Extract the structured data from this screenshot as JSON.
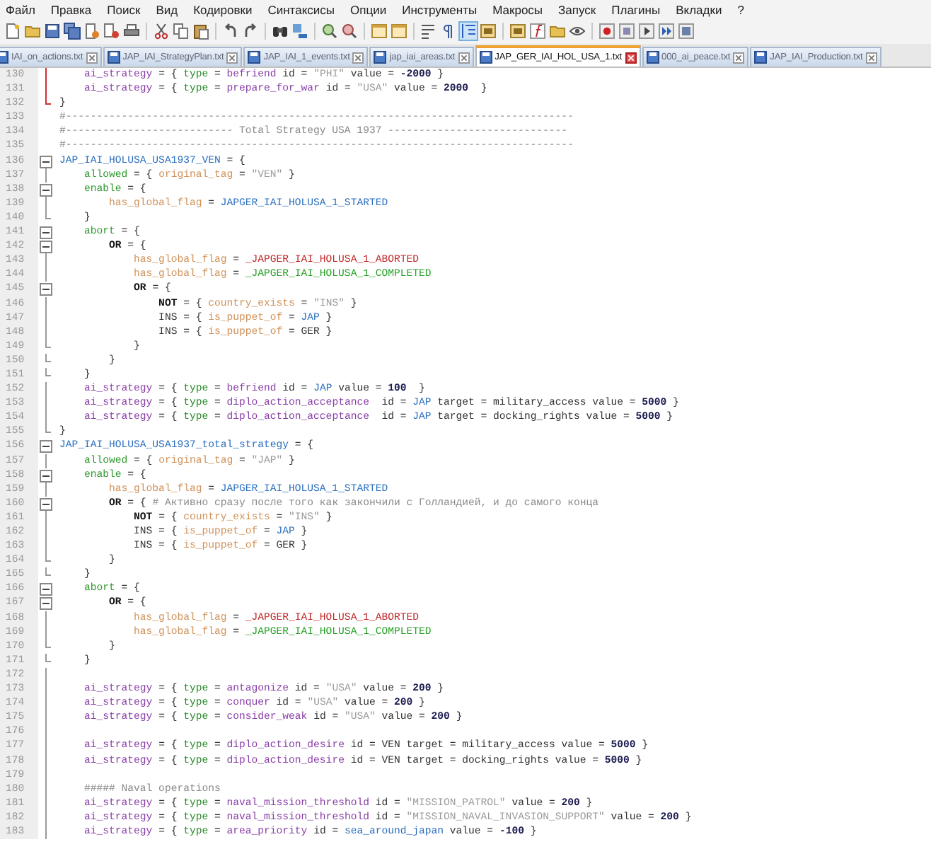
{
  "menu": [
    "Файл",
    "Правка",
    "Поиск",
    "Вид",
    "Кодировки",
    "Синтаксисы",
    "Опции",
    "Инструменты",
    "Макросы",
    "Запуск",
    "Плагины",
    "Вкладки",
    "?"
  ],
  "tabs": [
    {
      "label": "IAI_on_actions.txt",
      "selected": false
    },
    {
      "label": "JAP_IAI_StrategyPlan.txt",
      "selected": false
    },
    {
      "label": "JAP_IAI_1_events.txt",
      "selected": false
    },
    {
      "label": "jap_iai_areas.txt",
      "selected": false
    },
    {
      "label": "JAP_GER_IAI_HOL_USA_1.txt",
      "selected": true
    },
    {
      "label": "000_ai_peace.txt",
      "selected": false
    },
    {
      "label": "JAP_IAI_Production.txt",
      "selected": false
    }
  ],
  "lines": [
    {
      "number": "130",
      "kind": "inner",
      "current": true,
      "tokens": [
        {
          "kind": "keyword",
          "text": "    ai_strategy"
        },
        {
          "kind": "plain",
          "text": " = { "
        },
        {
          "kind": "type",
          "text": "type"
        },
        {
          "kind": "plain",
          "text": " = "
        },
        {
          "kind": "keyword",
          "text": "befriend"
        },
        {
          "kind": "plain",
          "text": " id = "
        },
        {
          "kind": "string",
          "text": "\"PHI\""
        },
        {
          "kind": "plain",
          "text": " value = "
        },
        {
          "kind": "number",
          "text": "-2000"
        },
        {
          "kind": "plain",
          "text": " }"
        }
      ]
    },
    {
      "number": "131",
      "kind": "inner",
      "current": true,
      "tokens": [
        {
          "kind": "keyword",
          "text": "    ai_strategy"
        },
        {
          "kind": "plain",
          "text": " = { "
        },
        {
          "kind": "type",
          "text": "type"
        },
        {
          "kind": "plain",
          "text": " = "
        },
        {
          "kind": "keyword",
          "text": "prepare_for_war"
        },
        {
          "kind": "plain",
          "text": " id = "
        },
        {
          "kind": "string",
          "text": "\"USA\""
        },
        {
          "kind": "plain",
          "text": " value = "
        },
        {
          "kind": "number",
          "text": "2000"
        },
        {
          "kind": "plain",
          "text": "  }"
        }
      ]
    },
    {
      "number": "132",
      "kind": "end",
      "current": true,
      "tokens": [
        {
          "kind": "plain",
          "text": "}"
        }
      ]
    },
    {
      "number": "133",
      "kind": "plain",
      "current": false,
      "tokens": [
        {
          "kind": "comment",
          "text": "#----------------------------------------------------------------------------------"
        }
      ]
    },
    {
      "number": "134",
      "kind": "plain",
      "current": false,
      "tokens": [
        {
          "kind": "comment",
          "text": "#--------------------------- Total Strategy USA 1937 -----------------------------"
        }
      ]
    },
    {
      "number": "135",
      "kind": "plain",
      "current": false,
      "tokens": [
        {
          "kind": "comment",
          "text": "#----------------------------------------------------------------------------------"
        }
      ]
    },
    {
      "number": "136",
      "kind": "open",
      "current": false,
      "tokens": [
        {
          "kind": "tag",
          "text": "JAP_IAI_HOLUSA_USA1937_VEN"
        },
        {
          "kind": "plain",
          "text": " = {"
        }
      ]
    },
    {
      "number": "137",
      "kind": "inner",
      "current": false,
      "tokens": [
        {
          "kind": "block",
          "text": "    allowed"
        },
        {
          "kind": "plain",
          "text": " = { "
        },
        {
          "kind": "trigger",
          "text": "original_tag"
        },
        {
          "kind": "plain",
          "text": " = "
        },
        {
          "kind": "string",
          "text": "\"VEN\""
        },
        {
          "kind": "plain",
          "text": " }"
        }
      ]
    },
    {
      "number": "138",
      "kind": "open",
      "current": false,
      "tokens": [
        {
          "kind": "block",
          "text": "    enable"
        },
        {
          "kind": "plain",
          "text": " = {"
        }
      ]
    },
    {
      "number": "139",
      "kind": "inner",
      "current": false,
      "tokens": [
        {
          "kind": "trigger",
          "text": "        has_global_flag"
        },
        {
          "kind": "plain",
          "text": " = "
        },
        {
          "kind": "tag",
          "text": "JAPGER_IAI_HOLUSA_1_STARTED"
        }
      ]
    },
    {
      "number": "140",
      "kind": "end",
      "current": false,
      "tokens": [
        {
          "kind": "plain",
          "text": "    }"
        }
      ]
    },
    {
      "number": "141",
      "kind": "open",
      "current": false,
      "tokens": [
        {
          "kind": "block",
          "text": "    abort"
        },
        {
          "kind": "plain",
          "text": " = {"
        }
      ]
    },
    {
      "number": "142",
      "kind": "open",
      "current": false,
      "tokens": [
        {
          "kind": "logic",
          "text": "        OR"
        },
        {
          "kind": "plain",
          "text": " = {"
        }
      ]
    },
    {
      "number": "143",
      "kind": "inner",
      "current": false,
      "tokens": [
        {
          "kind": "trigger",
          "text": "            has_global_flag"
        },
        {
          "kind": "plain",
          "text": " = "
        },
        {
          "kind": "aborted",
          "text": "_JAPGER_IAI_HOLUSA_1_ABORTED"
        }
      ]
    },
    {
      "number": "144",
      "kind": "inner",
      "current": false,
      "tokens": [
        {
          "kind": "trigger",
          "text": "            has_global_flag"
        },
        {
          "kind": "plain",
          "text": " = "
        },
        {
          "kind": "completed",
          "text": "_JAPGER_IAI_HOLUSA_1_COMPLETED"
        }
      ]
    },
    {
      "number": "145",
      "kind": "open",
      "current": false,
      "tokens": [
        {
          "kind": "logic",
          "text": "            OR"
        },
        {
          "kind": "plain",
          "text": " = {"
        }
      ]
    },
    {
      "number": "146",
      "kind": "inner",
      "current": false,
      "tokens": [
        {
          "kind": "logic",
          "text": "                NOT"
        },
        {
          "kind": "plain",
          "text": " = { "
        },
        {
          "kind": "trigger",
          "text": "country_exists"
        },
        {
          "kind": "plain",
          "text": " = "
        },
        {
          "kind": "string",
          "text": "\"INS\""
        },
        {
          "kind": "plain",
          "text": " }"
        }
      ]
    },
    {
      "number": "147",
      "kind": "inner",
      "current": false,
      "tokens": [
        {
          "kind": "plain",
          "text": "                INS = { "
        },
        {
          "kind": "trigger",
          "text": "is_puppet_of"
        },
        {
          "kind": "plain",
          "text": " = "
        },
        {
          "kind": "tag",
          "text": "JAP"
        },
        {
          "kind": "plain",
          "text": " }"
        }
      ]
    },
    {
      "number": "148",
      "kind": "inner",
      "current": false,
      "tokens": [
        {
          "kind": "plain",
          "text": "                INS = { "
        },
        {
          "kind": "trigger",
          "text": "is_puppet_of"
        },
        {
          "kind": "plain",
          "text": " = GER }"
        }
      ]
    },
    {
      "number": "149",
      "kind": "end",
      "current": false,
      "tokens": [
        {
          "kind": "plain",
          "text": "            }"
        }
      ]
    },
    {
      "number": "150",
      "kind": "end",
      "current": false,
      "tokens": [
        {
          "kind": "plain",
          "text": "        }"
        }
      ]
    },
    {
      "number": "151",
      "kind": "end",
      "current": false,
      "tokens": [
        {
          "kind": "plain",
          "text": "    }"
        }
      ]
    },
    {
      "number": "152",
      "kind": "inner",
      "current": false,
      "tokens": [
        {
          "kind": "keyword",
          "text": "    ai_strategy"
        },
        {
          "kind": "plain",
          "text": " = { "
        },
        {
          "kind": "type",
          "text": "type"
        },
        {
          "kind": "plain",
          "text": " = "
        },
        {
          "kind": "keyword",
          "text": "befriend"
        },
        {
          "kind": "plain",
          "text": " id = "
        },
        {
          "kind": "tag",
          "text": "JAP"
        },
        {
          "kind": "plain",
          "text": " value = "
        },
        {
          "kind": "number",
          "text": "100"
        },
        {
          "kind": "plain",
          "text": "  }"
        }
      ]
    },
    {
      "number": "153",
      "kind": "inner",
      "current": false,
      "tokens": [
        {
          "kind": "keyword",
          "text": "    ai_strategy"
        },
        {
          "kind": "plain",
          "text": " = { "
        },
        {
          "kind": "type",
          "text": "type"
        },
        {
          "kind": "plain",
          "text": " = "
        },
        {
          "kind": "keyword",
          "text": "diplo_action_acceptance"
        },
        {
          "kind": "plain",
          "text": "  id = "
        },
        {
          "kind": "tag",
          "text": "JAP"
        },
        {
          "kind": "plain",
          "text": " target = military_access value = "
        },
        {
          "kind": "number",
          "text": "5000"
        },
        {
          "kind": "plain",
          "text": " }"
        }
      ]
    },
    {
      "number": "154",
      "kind": "inner",
      "current": false,
      "tokens": [
        {
          "kind": "keyword",
          "text": "    ai_strategy"
        },
        {
          "kind": "plain",
          "text": " = { "
        },
        {
          "kind": "type",
          "text": "type"
        },
        {
          "kind": "plain",
          "text": " = "
        },
        {
          "kind": "keyword",
          "text": "diplo_action_acceptance"
        },
        {
          "kind": "plain",
          "text": "  id = "
        },
        {
          "kind": "tag",
          "text": "JAP"
        },
        {
          "kind": "plain",
          "text": " target = docking_rights value = "
        },
        {
          "kind": "number",
          "text": "5000"
        },
        {
          "kind": "plain",
          "text": " }"
        }
      ]
    },
    {
      "number": "155",
      "kind": "end",
      "current": false,
      "tokens": [
        {
          "kind": "plain",
          "text": "}"
        }
      ]
    },
    {
      "number": "156",
      "kind": "open",
      "current": false,
      "tokens": [
        {
          "kind": "tag",
          "text": "JAP_IAI_HOLUSA_USA1937_total_strategy"
        },
        {
          "kind": "plain",
          "text": " = {"
        }
      ]
    },
    {
      "number": "157",
      "kind": "inner",
      "current": false,
      "tokens": [
        {
          "kind": "block",
          "text": "    allowed"
        },
        {
          "kind": "plain",
          "text": " = { "
        },
        {
          "kind": "trigger",
          "text": "original_tag"
        },
        {
          "kind": "plain",
          "text": " = "
        },
        {
          "kind": "string",
          "text": "\"JAP\""
        },
        {
          "kind": "plain",
          "text": " }"
        }
      ]
    },
    {
      "number": "158",
      "kind": "open",
      "current": false,
      "tokens": [
        {
          "kind": "block",
          "text": "    enable"
        },
        {
          "kind": "plain",
          "text": " = {"
        }
      ]
    },
    {
      "number": "159",
      "kind": "inner",
      "current": false,
      "tokens": [
        {
          "kind": "trigger",
          "text": "        has_global_flag"
        },
        {
          "kind": "plain",
          "text": " = "
        },
        {
          "kind": "tag",
          "text": "JAPGER_IAI_HOLUSA_1_STARTED"
        }
      ]
    },
    {
      "number": "160",
      "kind": "open",
      "current": false,
      "tokens": [
        {
          "kind": "logic",
          "text": "        OR"
        },
        {
          "kind": "plain",
          "text": " = { "
        },
        {
          "kind": "comment",
          "text": "# Активно сразу после того как закончили с Голландией, и до самого конца"
        }
      ]
    },
    {
      "number": "161",
      "kind": "inner",
      "current": false,
      "tokens": [
        {
          "kind": "logic",
          "text": "            NOT"
        },
        {
          "kind": "plain",
          "text": " = { "
        },
        {
          "kind": "trigger",
          "text": "country_exists"
        },
        {
          "kind": "plain",
          "text": " = "
        },
        {
          "kind": "string",
          "text": "\"INS\""
        },
        {
          "kind": "plain",
          "text": " }"
        }
      ]
    },
    {
      "number": "162",
      "kind": "inner",
      "current": false,
      "tokens": [
        {
          "kind": "plain",
          "text": "            INS = { "
        },
        {
          "kind": "trigger",
          "text": "is_puppet_of"
        },
        {
          "kind": "plain",
          "text": " = "
        },
        {
          "kind": "tag",
          "text": "JAP"
        },
        {
          "kind": "plain",
          "text": " }"
        }
      ]
    },
    {
      "number": "163",
      "kind": "inner",
      "current": false,
      "tokens": [
        {
          "kind": "plain",
          "text": "            INS = { "
        },
        {
          "kind": "trigger",
          "text": "is_puppet_of"
        },
        {
          "kind": "plain",
          "text": " = GER }"
        }
      ]
    },
    {
      "number": "164",
      "kind": "end",
      "current": false,
      "tokens": [
        {
          "kind": "plain",
          "text": "        }"
        }
      ]
    },
    {
      "number": "165",
      "kind": "end",
      "current": false,
      "tokens": [
        {
          "kind": "plain",
          "text": "    }"
        }
      ]
    },
    {
      "number": "166",
      "kind": "open",
      "current": false,
      "tokens": [
        {
          "kind": "block",
          "text": "    abort"
        },
        {
          "kind": "plain",
          "text": " = {"
        }
      ]
    },
    {
      "number": "167",
      "kind": "open",
      "current": false,
      "tokens": [
        {
          "kind": "logic",
          "text": "        OR"
        },
        {
          "kind": "plain",
          "text": " = {"
        }
      ]
    },
    {
      "number": "168",
      "kind": "inner",
      "current": false,
      "tokens": [
        {
          "kind": "trigger",
          "text": "            has_global_flag"
        },
        {
          "kind": "plain",
          "text": " = "
        },
        {
          "kind": "aborted",
          "text": "_JAPGER_IAI_HOLUSA_1_ABORTED"
        }
      ]
    },
    {
      "number": "169",
      "kind": "inner",
      "current": false,
      "tokens": [
        {
          "kind": "trigger",
          "text": "            has_global_flag"
        },
        {
          "kind": "plain",
          "text": " = "
        },
        {
          "kind": "completed",
          "text": "_JAPGER_IAI_HOLUSA_1_COMPLETED"
        }
      ]
    },
    {
      "number": "170",
      "kind": "end",
      "current": false,
      "tokens": [
        {
          "kind": "plain",
          "text": "        }"
        }
      ]
    },
    {
      "number": "171",
      "kind": "end",
      "current": false,
      "tokens": [
        {
          "kind": "plain",
          "text": "    }"
        }
      ]
    },
    {
      "number": "172",
      "kind": "inner",
      "current": false
    },
    {
      "number": "173",
      "kind": "inner",
      "current": false,
      "tokens": [
        {
          "kind": "keyword",
          "text": "    ai_strategy"
        },
        {
          "kind": "plain",
          "text": " = { "
        },
        {
          "kind": "type",
          "text": "type"
        },
        {
          "kind": "plain",
          "text": " = "
        },
        {
          "kind": "keyword",
          "text": "antagonize"
        },
        {
          "kind": "plain",
          "text": " id = "
        },
        {
          "kind": "string",
          "text": "\"USA\""
        },
        {
          "kind": "plain",
          "text": " value = "
        },
        {
          "kind": "number",
          "text": "200"
        },
        {
          "kind": "plain",
          "text": " }"
        }
      ]
    },
    {
      "number": "174",
      "kind": "inner",
      "current": false,
      "tokens": [
        {
          "kind": "keyword",
          "text": "    ai_strategy"
        },
        {
          "kind": "plain",
          "text": " = { "
        },
        {
          "kind": "type",
          "text": "type"
        },
        {
          "kind": "plain",
          "text": " = "
        },
        {
          "kind": "keyword",
          "text": "conquer"
        },
        {
          "kind": "plain",
          "text": " id = "
        },
        {
          "kind": "string",
          "text": "\"USA\""
        },
        {
          "kind": "plain",
          "text": " value = "
        },
        {
          "kind": "number",
          "text": "200"
        },
        {
          "kind": "plain",
          "text": " }"
        }
      ]
    },
    {
      "number": "175",
      "kind": "inner",
      "current": false,
      "tokens": [
        {
          "kind": "keyword",
          "text": "    ai_strategy"
        },
        {
          "kind": "plain",
          "text": " = { "
        },
        {
          "kind": "type",
          "text": "type"
        },
        {
          "kind": "plain",
          "text": " = "
        },
        {
          "kind": "keyword",
          "text": "consider_weak"
        },
        {
          "kind": "plain",
          "text": " id = "
        },
        {
          "kind": "string",
          "text": "\"USA\""
        },
        {
          "kind": "plain",
          "text": " value = "
        },
        {
          "kind": "number",
          "text": "200"
        },
        {
          "kind": "plain",
          "text": " }"
        }
      ]
    },
    {
      "number": "176",
      "kind": "inner",
      "current": false
    },
    {
      "number": "177",
      "kind": "inner",
      "current": false,
      "tokens": [
        {
          "kind": "keyword",
          "text": "    ai_strategy"
        },
        {
          "kind": "plain",
          "text": " = { "
        },
        {
          "kind": "type",
          "text": "type"
        },
        {
          "kind": "plain",
          "text": " = "
        },
        {
          "kind": "keyword",
          "text": "diplo_action_desire"
        },
        {
          "kind": "plain",
          "text": " id = VEN target = military_access value = "
        },
        {
          "kind": "number",
          "text": "5000"
        },
        {
          "kind": "plain",
          "text": " }"
        }
      ]
    },
    {
      "number": "178",
      "kind": "inner",
      "current": false,
      "tokens": [
        {
          "kind": "keyword",
          "text": "    ai_strategy"
        },
        {
          "kind": "plain",
          "text": " = { "
        },
        {
          "kind": "type",
          "text": "type"
        },
        {
          "kind": "plain",
          "text": " = "
        },
        {
          "kind": "keyword",
          "text": "diplo_action_desire"
        },
        {
          "kind": "plain",
          "text": " id = VEN target = docking_rights value = "
        },
        {
          "kind": "number",
          "text": "5000"
        },
        {
          "kind": "plain",
          "text": " }"
        }
      ]
    },
    {
      "number": "179",
      "kind": "inner",
      "current": false
    },
    {
      "number": "180",
      "kind": "inner",
      "current": false,
      "tokens": [
        {
          "kind": "comment",
          "text": "    ##### Naval operations"
        }
      ]
    },
    {
      "number": "181",
      "kind": "inner",
      "current": false,
      "tokens": [
        {
          "kind": "keyword",
          "text": "    ai_strategy"
        },
        {
          "kind": "plain",
          "text": " = { "
        },
        {
          "kind": "type",
          "text": "type"
        },
        {
          "kind": "plain",
          "text": " = "
        },
        {
          "kind": "keyword",
          "text": "naval_mission_threshold"
        },
        {
          "kind": "plain",
          "text": " id = "
        },
        {
          "kind": "string",
          "text": "\"MISSION_PATROL\""
        },
        {
          "kind": "plain",
          "text": " value = "
        },
        {
          "kind": "number",
          "text": "200"
        },
        {
          "kind": "plain",
          "text": " }"
        }
      ]
    },
    {
      "number": "182",
      "kind": "inner",
      "current": false,
      "tokens": [
        {
          "kind": "keyword",
          "text": "    ai_strategy"
        },
        {
          "kind": "plain",
          "text": " = { "
        },
        {
          "kind": "type",
          "text": "type"
        },
        {
          "kind": "plain",
          "text": " = "
        },
        {
          "kind": "keyword",
          "text": "naval_mission_threshold"
        },
        {
          "kind": "plain",
          "text": " id = "
        },
        {
          "kind": "string",
          "text": "\"MISSION_NAVAL_INVASION_SUPPORT\""
        },
        {
          "kind": "plain",
          "text": " value = "
        },
        {
          "kind": "number",
          "text": "200"
        },
        {
          "kind": "plain",
          "text": " }"
        }
      ]
    },
    {
      "number": "183",
      "kind": "inner",
      "current": false,
      "tokens": [
        {
          "kind": "keyword",
          "text": "    ai_strategy"
        },
        {
          "kind": "plain",
          "text": " = { "
        },
        {
          "kind": "type",
          "text": "type"
        },
        {
          "kind": "plain",
          "text": " = "
        },
        {
          "kind": "keyword",
          "text": "area_priority"
        },
        {
          "kind": "plain",
          "text": " id = "
        },
        {
          "kind": "tag",
          "text": "sea_around_japan"
        },
        {
          "kind": "plain",
          "text": " value = "
        },
        {
          "kind": "number",
          "text": "-100"
        },
        {
          "kind": "plain",
          "text": " }"
        }
      ]
    }
  ]
}
